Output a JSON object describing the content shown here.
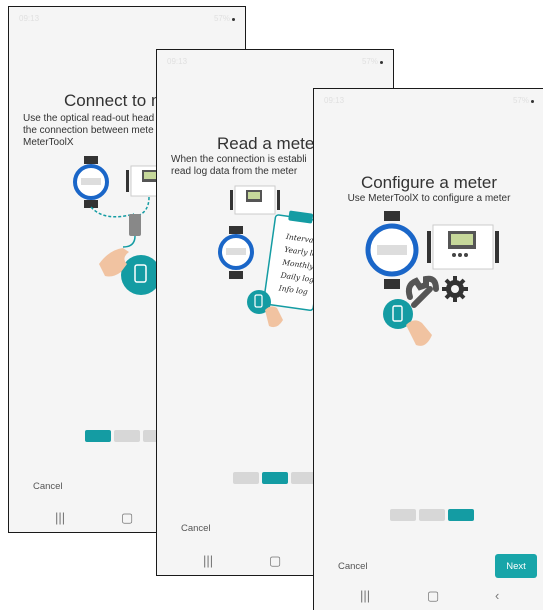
{
  "status_bar": {
    "time": "09:13",
    "battery": "57%"
  },
  "screen1": {
    "title": "Connect to m",
    "subtitle_lines": [
      "Use the optical read-out head",
      "the connection between mete",
      "MeterToolX"
    ],
    "cancel_label": "Cancel",
    "step_active": 1
  },
  "screen2": {
    "title": "Read a meter",
    "subtitle_lines": [
      "When the connection is establi",
      "read log data from the meter"
    ],
    "log_items": [
      "Interval log",
      "Yearly log",
      "Monthly log",
      "Daily log",
      "Info log"
    ],
    "cancel_label": "Cancel",
    "step_active": 2
  },
  "screen3": {
    "title": "Configure a meter",
    "subtitle": "Use MeterToolX to configure a meter",
    "cancel_label": "Cancel",
    "next_label": "Next",
    "step_active": 3
  },
  "nav_icons": [
    "recent-apps-icon",
    "home-icon",
    "back-icon"
  ],
  "colors": {
    "accent": "#149ca3",
    "meter_ring": "#1a66c8",
    "inactive_step": "#d7d7d7"
  }
}
